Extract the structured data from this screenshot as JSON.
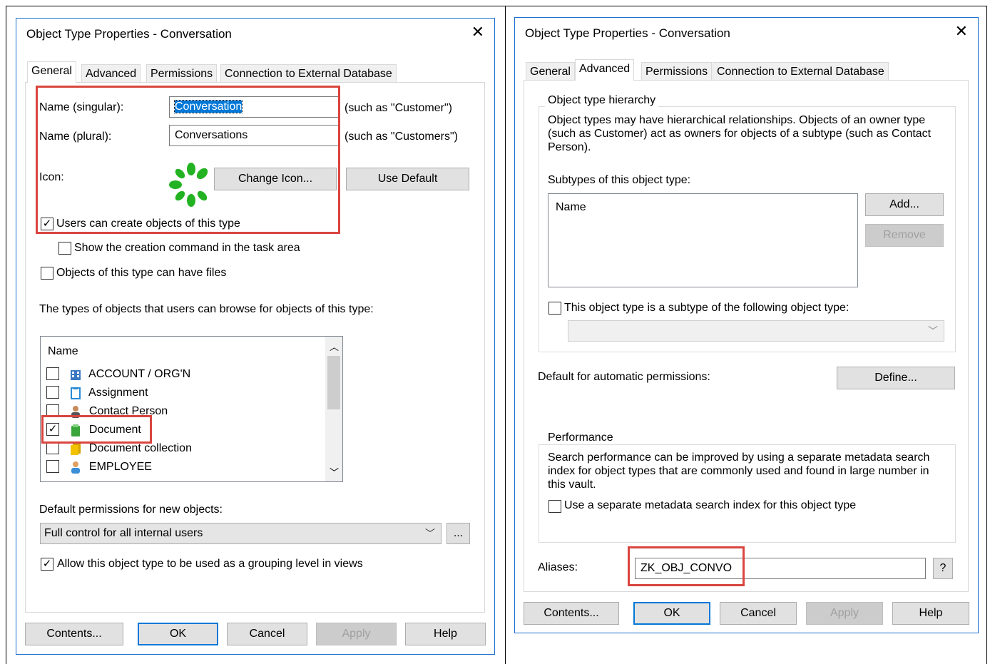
{
  "left": {
    "title": "Object Type Properties - Conversation",
    "tabs": [
      "General",
      "Advanced",
      "Permissions",
      "Connection to External Database"
    ],
    "name_singular_label": "Name (singular):",
    "name_singular_value": "Conversation",
    "name_singular_hint": "(such as \"Customer\")",
    "name_plural_label": "Name (plural):",
    "name_plural_value": "Conversations",
    "name_plural_hint": "(such as \"Customers\")",
    "icon_label": "Icon:",
    "change_icon_button": "Change Icon...",
    "use_default_button": "Use Default",
    "users_can_create_label": "Users can create objects of this type",
    "show_creation_label": "Show the creation command in the task area",
    "can_have_files_label": "Objects of this type can have files",
    "browse_types_label": "The types of objects that users can browse for objects of this type:",
    "list_header": "Name",
    "list_items": [
      {
        "label": "ACCOUNT / ORG'N",
        "checked": false,
        "icon": "building-icon"
      },
      {
        "label": "Assignment",
        "checked": false,
        "icon": "clipboard-icon"
      },
      {
        "label": "Contact Person",
        "checked": false,
        "icon": "person-icon"
      },
      {
        "label": "Document",
        "checked": true,
        "icon": "document-icon"
      },
      {
        "label": "Document collection",
        "checked": false,
        "icon": "document-collection-icon"
      },
      {
        "label": "EMPLOYEE",
        "checked": false,
        "icon": "employee-icon"
      }
    ],
    "default_permissions_label": "Default permissions for new objects:",
    "default_permissions_value": "Full control for all internal users",
    "ellipsis_button": "...",
    "grouping_label": "Allow this object type to be used as a grouping level in views",
    "buttons": {
      "contents": "Contents...",
      "ok": "OK",
      "cancel": "Cancel",
      "apply": "Apply",
      "help": "Help"
    }
  },
  "right": {
    "title": "Object Type Properties - Conversation",
    "tabs": [
      "General",
      "Advanced",
      "Permissions",
      "Connection to External Database"
    ],
    "hierarchy_group_title": "Object type hierarchy",
    "hierarchy_text": "Object types may have hierarchical relationships. Objects of an owner type (such as Customer) act as owners for objects of a subtype (such as Contact Person).",
    "subtypes_label": "Subtypes of this object type:",
    "subtypes_header": "Name",
    "add_button": "Add...",
    "remove_button": "Remove",
    "is_subtype_label": "This object type is a subtype of the following object type:",
    "auto_permissions_label": "Default for automatic permissions:",
    "define_button": "Define...",
    "performance_group_title": "Performance",
    "performance_text": "Search performance can be improved by using a separate metadata search index for object types that are commonly used and found in large number in this vault.",
    "separate_index_label": "Use a separate metadata search index for this object type",
    "aliases_label": "Aliases:",
    "aliases_value": "ZK_OBJ_CONVO",
    "aliases_help_button": "?",
    "buttons": {
      "contents": "Contents...",
      "ok": "OK",
      "cancel": "Cancel",
      "apply": "Apply",
      "help": "Help"
    }
  },
  "colors": {
    "highlight": "#d9453f",
    "accent": "#0078d7",
    "dialog_border": "#1a6fd0"
  }
}
